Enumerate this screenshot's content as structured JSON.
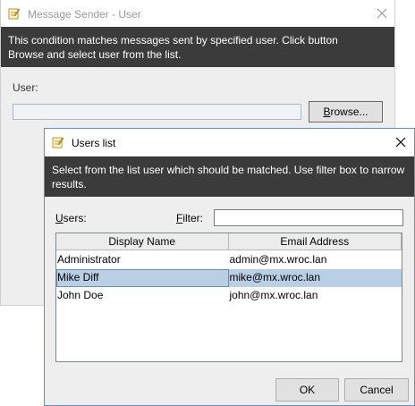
{
  "background_window": {
    "title": "Message Sender - User",
    "description": "This condition matches messages sent by specified user. Click button Browse and select user from the list.",
    "user_label": "User:",
    "user_value": "",
    "browse_button": {
      "prefix": "",
      "mnemonic": "B",
      "rest": "rowse..."
    }
  },
  "dialog": {
    "title": "Users list",
    "description": "Select from the list user which should be matched. Use filter box to narrow results.",
    "users_label": {
      "mnemonic": "U",
      "rest": "sers:"
    },
    "filter_label": {
      "mnemonic": "F",
      "rest": "ilter:"
    },
    "filter_value": "",
    "table": {
      "columns": [
        "Display Name",
        "Email Address"
      ],
      "rows": [
        {
          "name": "Administrator",
          "email": "admin@mx.wroc.lan",
          "selected": false
        },
        {
          "name": "Mike Diff",
          "email": "mike@mx.wroc.lan",
          "selected": true
        },
        {
          "name": "John Doe",
          "email": "john@mx.wroc.lan",
          "selected": false
        }
      ]
    },
    "ok_label": "OK",
    "cancel_label": "Cancel"
  },
  "icons": {
    "title_icon": "notepad-icon",
    "close_icon": "close-icon"
  },
  "colors": {
    "banner_bg": "#3b3b3b",
    "selection_bg": "#b8cfe5",
    "dialog_border": "#5b8fd6"
  }
}
